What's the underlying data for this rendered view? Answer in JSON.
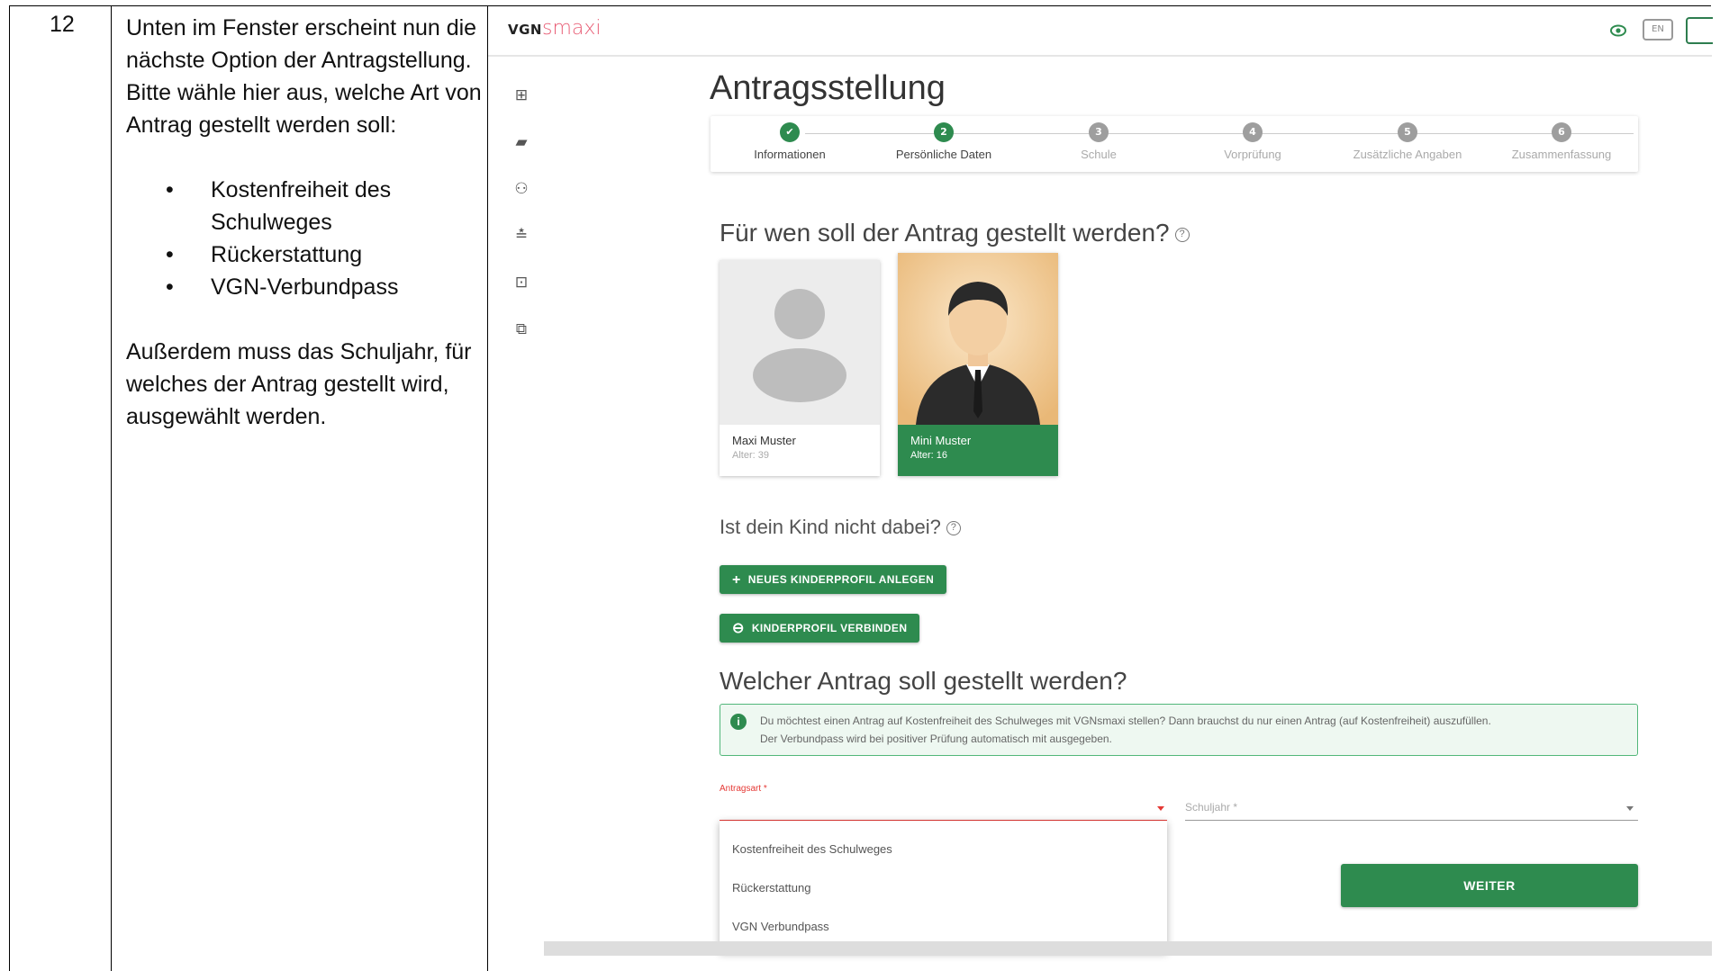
{
  "step_number": "12",
  "instructions": {
    "line1": "Unten im Fenster erscheint nun die nächste Option der Antragstellung.",
    "line2": "Bitte wähle hier aus, welche Art von Antrag gestellt werden soll:",
    "bullets": [
      "Kostenfreiheit des Schulweges",
      "Rückerstattung",
      "VGN-Verbundpass"
    ],
    "note": "Außerdem muss das Schuljahr, für welches der Antrag gestellt wird, ausgewählt werden."
  },
  "app": {
    "logo_vgn": "VGN",
    "logo_smaxi": "smaxi",
    "lang_button": "EN",
    "page_title": "Antragsstellung",
    "steps": [
      {
        "label": "Informationen",
        "marker": "✔",
        "state": "done"
      },
      {
        "label": "Persönliche Daten",
        "marker": "2",
        "state": "active"
      },
      {
        "label": "Schule",
        "marker": "3",
        "state": "todo"
      },
      {
        "label": "Vorprüfung",
        "marker": "4",
        "state": "todo"
      },
      {
        "label": "Zusätzliche Angaben",
        "marker": "5",
        "state": "todo"
      },
      {
        "label": "Zusammenfassung",
        "marker": "6",
        "state": "todo"
      }
    ],
    "question_for_whom": "Für wen soll der Antrag gestellt werden?",
    "profiles": [
      {
        "name": "Maxi Muster",
        "age": "Alter: 39",
        "selected": false
      },
      {
        "name": "Mini Muster",
        "age": "Alter: 16",
        "selected": true
      }
    ],
    "child_missing": "Ist dein Kind nicht dabei?",
    "btn_new_profile": "NEUES KINDERPROFIL ANLEGEN",
    "btn_connect_profile": "KINDERPROFIL VERBINDEN",
    "question_which": "Welcher Antrag soll gestellt werden?",
    "info_text_1": "Du möchtest einen Antrag auf Kostenfreiheit des Schulweges mit VGNsmaxi stellen? Dann brauchst du nur einen Antrag (auf Kostenfreiheit) auszufüllen.",
    "info_text_2": "Der Verbundpass wird bei positiver Prüfung automatisch mit ausgegeben.",
    "antragsart_label": "Antragsart *",
    "schuljahr_label": "Schuljahr *",
    "dropdown_options": [
      "Kostenfreiheit des Schulweges",
      "Rückerstattung",
      "VGN Verbundpass"
    ],
    "btn_next": "WEITER"
  },
  "colors": {
    "brand_green": "#2e8b4f",
    "logo_pink": "#e85d75",
    "error_red": "#e53935"
  }
}
